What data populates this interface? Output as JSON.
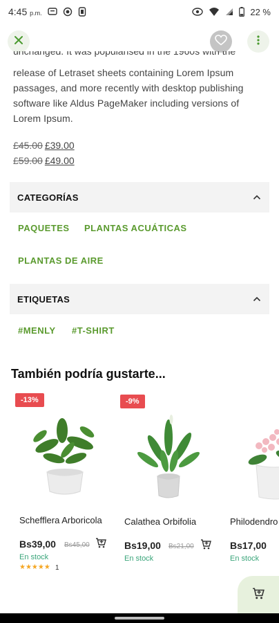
{
  "status_bar": {
    "time": "4:45",
    "time_suffix": "p.m.",
    "battery": "22 %"
  },
  "description": {
    "cut_line": "unchanged. It was popularised in the 1960s with the",
    "text": "release of Letraset sheets containing Lorem Ipsum passages, and more recently with desktop publishing software like Aldus PageMaker including versions of Lorem Ipsum."
  },
  "prices": [
    {
      "old": "£45.00",
      "new": "£39.00"
    },
    {
      "old": "£59.00",
      "new": "£49.00"
    }
  ],
  "categories": {
    "title": "CATEGORÍAS",
    "items": [
      "PAQUETES",
      "PLANTAS ACUÁTICAS",
      "PLANTAS DE AIRE"
    ]
  },
  "tags": {
    "title": "ETIQUETAS",
    "items": [
      "#MENLY",
      "#T-SHIRT"
    ]
  },
  "related": {
    "title": "También podría gustarte...",
    "products": [
      {
        "name": "Schefflera Arboricola",
        "discount": "-13%",
        "price": "Bs39,00",
        "old_price": "Bs45,00",
        "stock": "En stock",
        "rating_stars": "★★★★★",
        "rating_count": "1"
      },
      {
        "name": "Calathea Orbifolia",
        "discount": "-9%",
        "price": "Bs19,00",
        "old_price": "Bs21,00",
        "stock": "En stock"
      },
      {
        "name": "Philodendro",
        "price": "Bs17,00",
        "stock": "En stock"
      }
    ]
  },
  "colors": {
    "accent_green": "#5a9a2e",
    "discount_red": "#e84c50",
    "stock_green": "#3aa57a"
  }
}
